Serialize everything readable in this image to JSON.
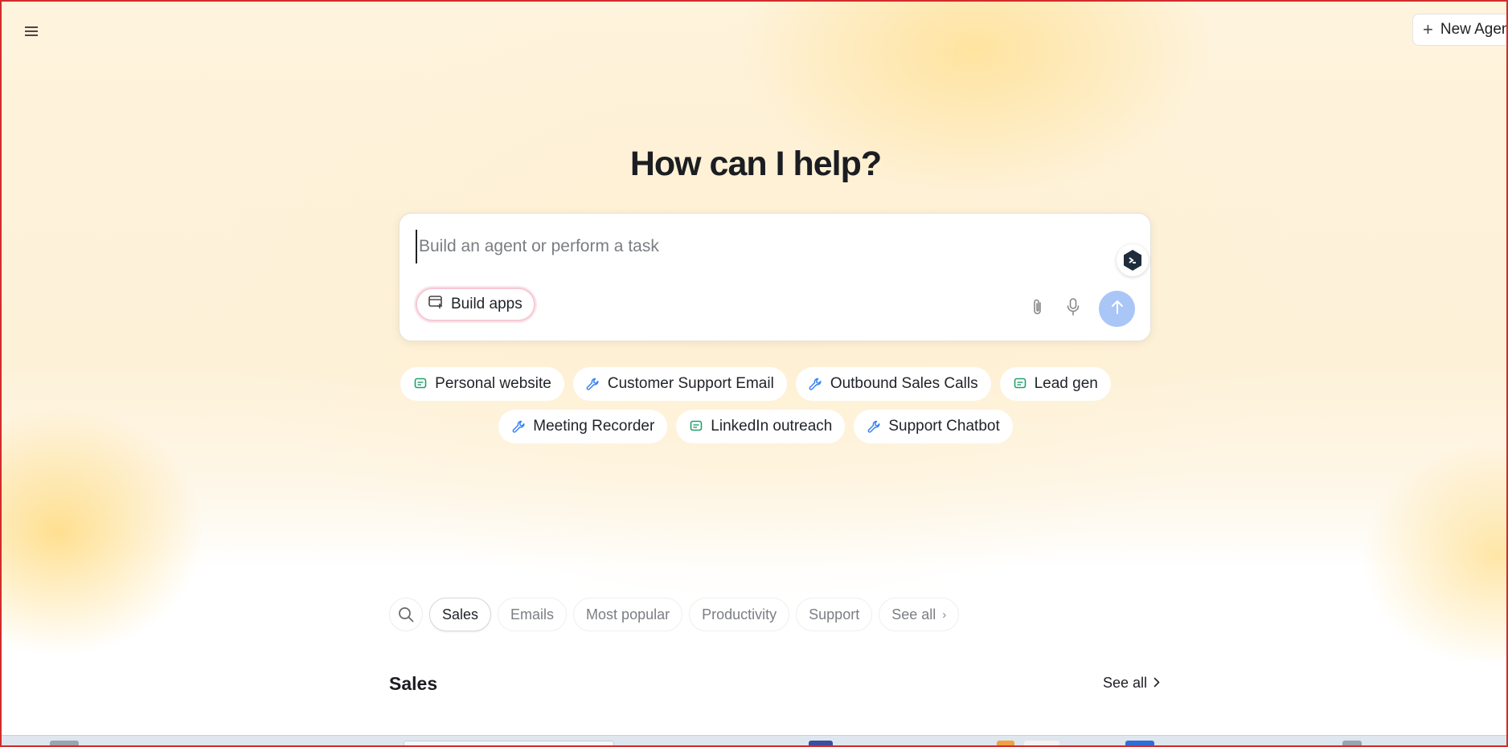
{
  "header": {
    "menu_icon": "hamburger-menu-icon",
    "new_agent_label": "New Agen"
  },
  "hero": {
    "title": "How can I help?"
  },
  "prompt": {
    "placeholder": "Build an agent or perform a task",
    "build_apps_label": "Build apps",
    "icons": [
      "app-badge-icon",
      "paperclip-icon",
      "microphone-icon",
      "arrow-up-icon"
    ]
  },
  "suggestions": {
    "row1": [
      {
        "label": "Personal website",
        "icon": "chat-bubble-icon"
      },
      {
        "label": "Customer Support Email",
        "icon": "wrench-icon"
      },
      {
        "label": "Outbound Sales Calls",
        "icon": "wrench-icon"
      },
      {
        "label": "Lead gen",
        "icon": "chat-bubble-icon"
      }
    ],
    "row2": [
      {
        "label": "Meeting Recorder",
        "icon": "wrench-icon"
      },
      {
        "label": "LinkedIn outreach",
        "icon": "chat-bubble-icon"
      },
      {
        "label": "Support Chatbot",
        "icon": "wrench-icon"
      }
    ]
  },
  "categories": {
    "items": [
      "Sales",
      "Emails",
      "Most popular",
      "Productivity",
      "Support",
      "See all"
    ],
    "active": "Sales"
  },
  "section": {
    "title": "Sales",
    "see_all_label": "See all"
  },
  "colors": {
    "chip_icon_green": "#22a06b",
    "chip_icon_blue": "#3b82f6",
    "send_button": "#a9c6f7",
    "frame_border": "#d32b2b"
  }
}
